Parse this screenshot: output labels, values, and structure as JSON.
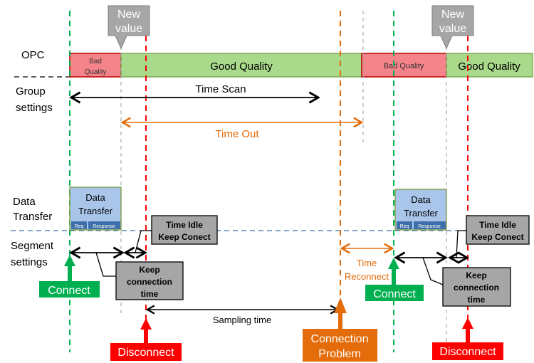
{
  "labels": {
    "opc": "OPC",
    "group_1": "Group",
    "group_2": "settings",
    "data_1": "Data",
    "data_2": "Transfer",
    "segment_1": "Segment",
    "segment_2": "settings"
  },
  "opc_bar": {
    "bad1_line1": "Bad",
    "bad1_line2": "Quality",
    "good1": "Good Quality",
    "bad2": "Bad Quality",
    "good2": "Good Quality"
  },
  "callouts": {
    "new_value_1": "New",
    "new_value_2": "value"
  },
  "arrows": {
    "time_scan": "Time Scan",
    "time_out": "Time Out",
    "sampling_time": "Sampling time",
    "time_reconnect_1": "Time",
    "time_reconnect_2": "Reconnect"
  },
  "data_transfer": {
    "line1": "Data",
    "line2": "Transfer",
    "req": "Req",
    "response": "Response"
  },
  "boxes": {
    "idle_1": "Time Idle",
    "idle_2": "Keep Conect",
    "keep_1": "Keep",
    "keep_2": "connection",
    "keep_3": "time"
  },
  "events": {
    "connect": "Connect",
    "disconnect": "Disconnect",
    "problem_1": "Connection",
    "problem_2": "Problem"
  },
  "colors": {
    "bad": "#f4848a",
    "good": "#a9d98a",
    "connect": "#00b050",
    "disconnect": "#ff0000",
    "problem": "#e46c0a",
    "transfer": "#a9c6ea",
    "box": "#a6a6a6"
  }
}
